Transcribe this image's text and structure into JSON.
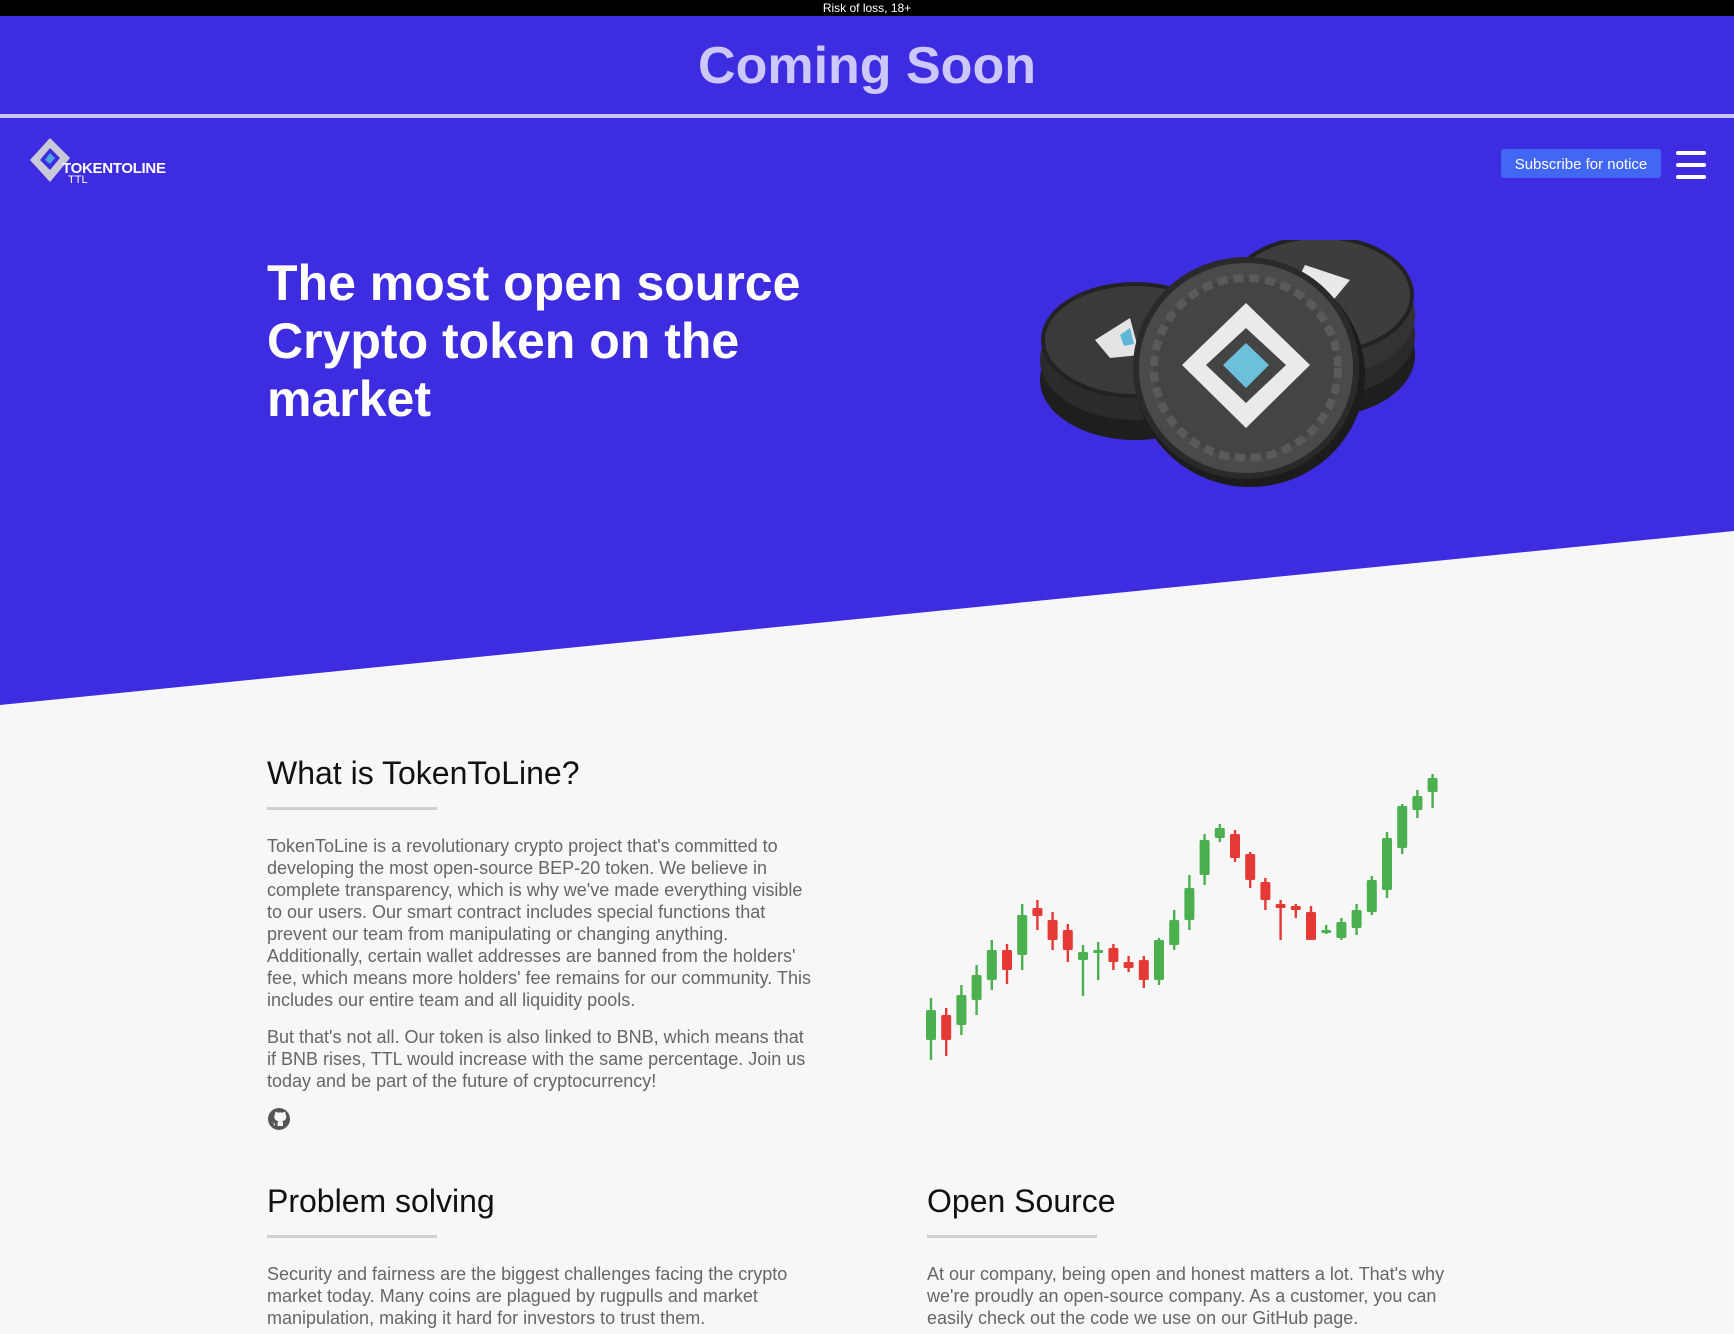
{
  "risk_notice": "Risk of loss, 18+",
  "banner": {
    "title": "Coming Soon"
  },
  "header": {
    "logo_name": "TOKENTOLINE",
    "logo_ticker": "TTL",
    "subscribe_label": "Subscribe for notice",
    "menu_icon": "hamburger-menu-icon"
  },
  "hero": {
    "title": "The most open source Crypto token on the market",
    "image": "stacked-ttl-coins"
  },
  "about": {
    "heading": "What is TokenToLine?",
    "paragraph_1": "TokenToLine is a revolutionary crypto project that's committed to developing the most open-source BEP-20 token. We believe in complete transparency, which is why we've made everything visible to our users. Our smart contract includes special functions that prevent our team from manipulating or changing anything. Additionally, certain wallet addresses are banned from the holders' fee, which means more holders' fee remains for our community. This includes our entire team and all liquidity pools.",
    "paragraph_2": "But that's not all. Our token is also linked to BNB, which means that if BNB rises, TTL would increase with the same percentage. Join us today and be part of the future of cryptocurrency!",
    "link_icon": "github-icon",
    "illustration": "candlestick-uptrend-illustration"
  },
  "problem": {
    "heading": "Problem solving",
    "paragraph": "Security and fairness are the biggest challenges facing the crypto market today. Many coins are plagued by rugpulls and market manipulation, making it hard for investors to trust them."
  },
  "open_source": {
    "heading": "Open Source",
    "paragraph": "At our company, being open and honest matters a lot. That's why we're proudly an open-source company. As a customer, you can easily check out the code we use on our GitHub page."
  },
  "colors": {
    "hero_bg": "#3e2ce1",
    "button_bg": "#4267f2",
    "candle_up": "#4caf50",
    "candle_down": "#e53935"
  }
}
